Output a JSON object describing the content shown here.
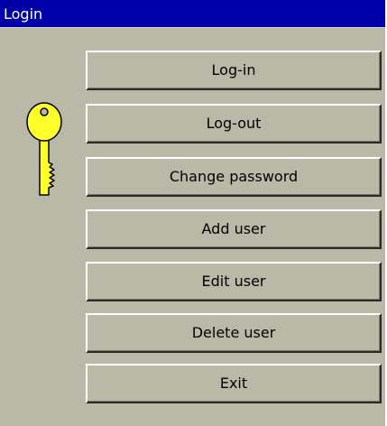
{
  "window": {
    "title": "Login"
  },
  "icon": "key-icon",
  "colors": {
    "titlebar": "#0000a8",
    "background": "#bab8a7",
    "key": "#ffff2a"
  },
  "buttons": {
    "login": "Log-in",
    "logout": "Log-out",
    "change_password": "Change password",
    "add_user": "Add user",
    "edit_user": "Edit user",
    "delete_user": "Delete user",
    "exit": "Exit"
  }
}
